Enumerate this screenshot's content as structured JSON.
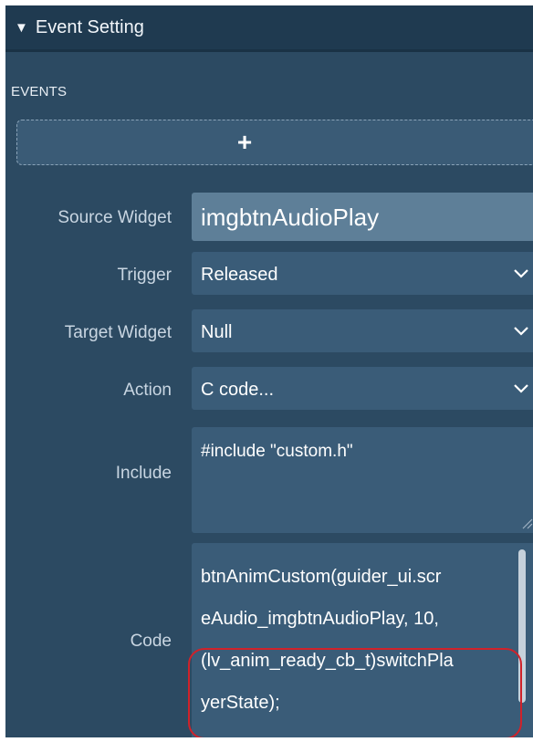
{
  "header": {
    "title": "Event Setting",
    "toggle_icon": "triangle-down-icon"
  },
  "events": {
    "label": "EVENTS",
    "add_button": "+"
  },
  "form": {
    "source_widget": {
      "label": "Source Widget",
      "value": "imgbtnAudioPlay"
    },
    "trigger": {
      "label": "Trigger",
      "value": "Released"
    },
    "target_widget": {
      "label": "Target Widget",
      "value": "Null"
    },
    "action": {
      "label": "Action",
      "value": "C code..."
    },
    "include": {
      "label": "Include",
      "value": "#include \"custom.h\""
    },
    "code": {
      "label": "Code",
      "lines": [
        "btnAnimCustom(guider_ui.scr",
        "eAudio_imgbtnAudioPlay, 10,",
        "(lv_anim_ready_cb_t)switchPla",
        "yerState);"
      ]
    }
  },
  "colors": {
    "panel": "#2c4a62",
    "header": "#1f3a50",
    "field": "#3a5c78",
    "highlight": "#d0222a"
  }
}
